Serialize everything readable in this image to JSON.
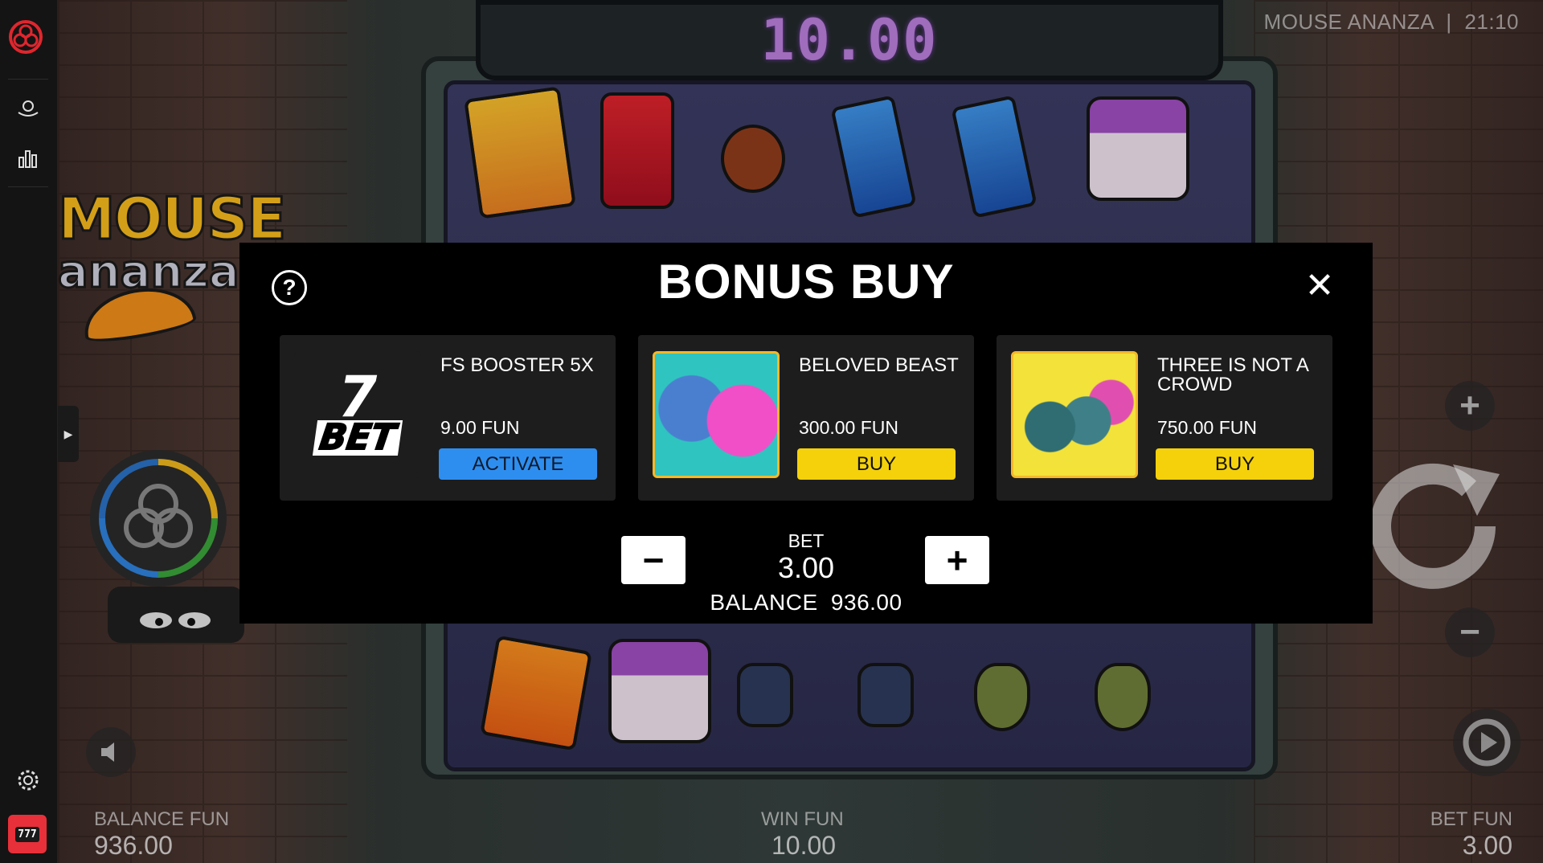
{
  "sidebar": {
    "items": [
      {
        "icon": "ball-on-hand-icon"
      },
      {
        "icon": "bar-chart-icon"
      }
    ],
    "settings_icon": "gear-icon",
    "app_icon": "slot-machine-icon",
    "app_text": "777"
  },
  "game": {
    "title": "MOUSE ANANZA",
    "separator": "|",
    "clock": "21:10",
    "logo_line1": "MOUSE",
    "logo_line2": "ananza",
    "win_display": "10.00",
    "balance_label": "BALANCE FUN",
    "balance_value": "936.00",
    "win_label": "WIN FUN",
    "win_value": "10.00",
    "bet_label": "BET FUN",
    "bet_value": "3.00",
    "top_symbols": [
      "magazine",
      "soda-can",
      "apple-core",
      "candy-wrapper",
      "candy-wrapper",
      "ice-cream-tub"
    ],
    "bottom_symbols": [
      "chips-bag",
      "ice-cream-tub",
      "blueberries",
      "blueberries",
      "pear",
      "pear"
    ],
    "colors": {
      "win_display": "#b77bd6",
      "reel_bg": "#3b3b63"
    }
  },
  "modal": {
    "title": "BONUS BUY",
    "help_glyph": "?",
    "close_glyph": "✕",
    "cards": [
      {
        "name": "FS BOOSTER 5X",
        "price": "9.00 FUN",
        "button": "ACTIVATE",
        "thumb": "7bet-logo",
        "logo_text_top": "7",
        "logo_text_mid": "BET"
      },
      {
        "name": "BELOVED BEAST",
        "price": "300.00 FUN",
        "button": "BUY",
        "thumb": "beloved-beast-art"
      },
      {
        "name": "THREE IS NOT A CROWD",
        "price": "750.00 FUN",
        "button": "BUY",
        "thumb": "three-is-not-a-crowd-art"
      }
    ],
    "bet": {
      "label": "BET",
      "value": "3.00",
      "minus": "−",
      "plus": "+"
    },
    "balance": {
      "label": "BALANCE",
      "value": "936.00"
    },
    "colors": {
      "activate": "#2e8ef0",
      "buy": "#f4d10b"
    }
  }
}
